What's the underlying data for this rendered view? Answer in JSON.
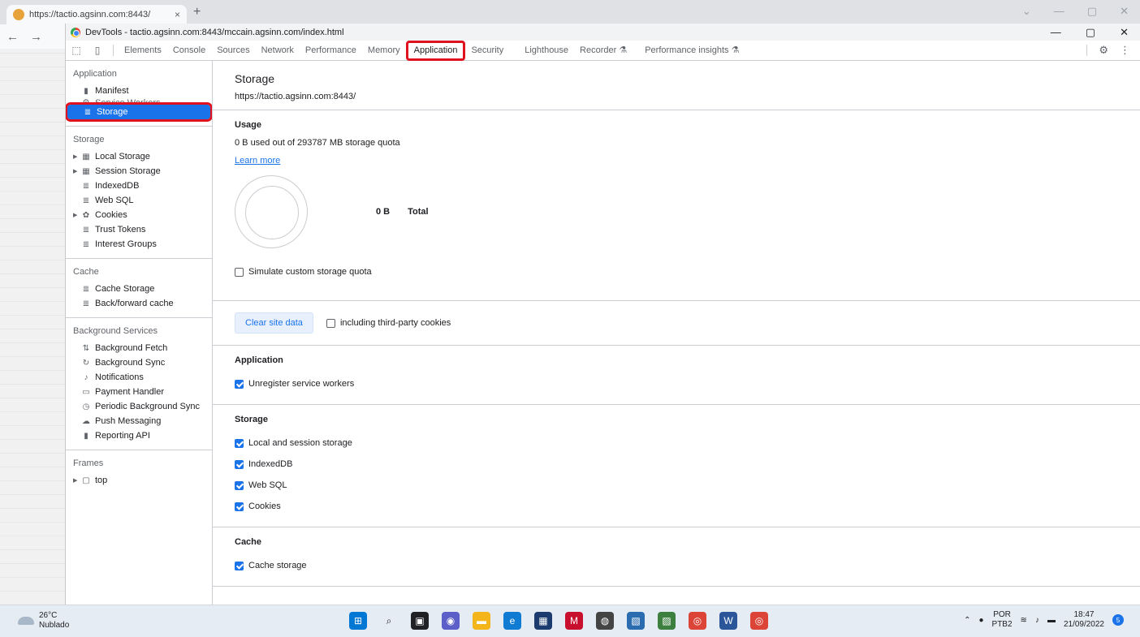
{
  "browser": {
    "tab_title": "https://tactio.agsinn.com:8443/",
    "tab_close": "×",
    "new_tab": "+"
  },
  "devtools": {
    "window_title": "DevTools - tactio.agsinn.com:8443/mccain.agsinn.com/index.html",
    "tabs": [
      "Elements",
      "Console",
      "Sources",
      "Network",
      "Performance",
      "Memory",
      "Application",
      "Security",
      "Lighthouse",
      "Recorder ⚗",
      "Performance insights ⚗"
    ],
    "active_tab": "Application"
  },
  "sidebar": {
    "application": {
      "header": "Application",
      "items": [
        "Manifest",
        "Service Workers",
        "Storage"
      ]
    },
    "storage": {
      "header": "Storage",
      "items": [
        "Local Storage",
        "Session Storage",
        "IndexedDB",
        "Web SQL",
        "Cookies",
        "Trust Tokens",
        "Interest Groups"
      ]
    },
    "cache": {
      "header": "Cache",
      "items": [
        "Cache Storage",
        "Back/forward cache"
      ]
    },
    "background": {
      "header": "Background Services",
      "items": [
        "Background Fetch",
        "Background Sync",
        "Notifications",
        "Payment Handler",
        "Periodic Background Sync",
        "Push Messaging",
        "Reporting API"
      ]
    },
    "frames": {
      "header": "Frames",
      "items": [
        "top"
      ]
    }
  },
  "main": {
    "title": "Storage",
    "origin": "https://tactio.agsinn.com:8443/",
    "usage": {
      "title": "Usage",
      "text": "0 B used out of 293787 MB storage quota",
      "learn_more": "Learn more",
      "pie_value": "0 B",
      "pie_label": "Total",
      "simulate": "Simulate custom storage quota",
      "simulate_checked": false
    },
    "clear": {
      "button": "Clear site data",
      "third_party": "including third-party cookies",
      "third_party_checked": false
    },
    "application": {
      "title": "Application",
      "options": [
        {
          "label": "Unregister service workers",
          "checked": true
        }
      ]
    },
    "storage": {
      "title": "Storage",
      "options": [
        {
          "label": "Local and session storage",
          "checked": true
        },
        {
          "label": "IndexedDB",
          "checked": true
        },
        {
          "label": "Web SQL",
          "checked": true
        },
        {
          "label": "Cookies",
          "checked": true
        }
      ]
    },
    "cache": {
      "title": "Cache",
      "options": [
        {
          "label": "Cache storage",
          "checked": true
        }
      ]
    }
  },
  "taskbar": {
    "temp": "26°C",
    "weather": "Nublado",
    "lang1": "POR",
    "lang2": "PTB2",
    "time": "18:47",
    "date": "21/09/2022",
    "notif": "5"
  }
}
